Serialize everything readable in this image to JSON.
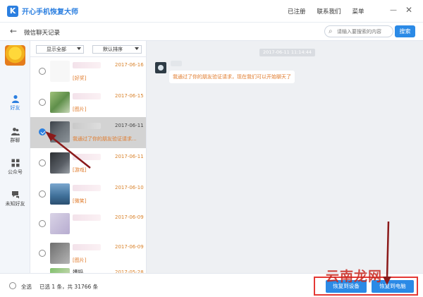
{
  "app": {
    "title": "开心手机恢复大师",
    "logo_letter": "K",
    "links": [
      "已注册",
      "联系我们",
      "菜单"
    ],
    "window_controls": [
      "minimize-icon",
      "maximize-icon",
      "close-icon"
    ]
  },
  "header": {
    "page_title": "微信聊天记录",
    "search_placeholder": "请输入要搜索的内容",
    "search_button": "搜索"
  },
  "nav": {
    "items": [
      {
        "label": "好友",
        "icon": "person-icon",
        "active": true
      },
      {
        "label": "群聊",
        "icon": "group-icon",
        "active": false
      },
      {
        "label": "公众号",
        "icon": "grid-icon",
        "active": false
      },
      {
        "label": "未知好友",
        "icon": "chat-icon",
        "active": false
      }
    ]
  },
  "list": {
    "filter_show": "显示全部",
    "filter_sort": "默认排序",
    "rows": [
      {
        "date": "2017-06-16",
        "message": "[好奖]",
        "selected": false,
        "name": ""
      },
      {
        "date": "2017-06-15",
        "message": "[图片]",
        "selected": false,
        "name": ""
      },
      {
        "date": "2017-06-11",
        "message": "我通过了你的朋友验证请求...",
        "selected": true,
        "name": ""
      },
      {
        "date": "2017-06-11",
        "message": "[游戏]",
        "selected": false,
        "name": ""
      },
      {
        "date": "2017-06-10",
        "message": "[微笑]",
        "selected": false,
        "name": ""
      },
      {
        "date": "2017-06-09",
        "message": "",
        "selected": false,
        "name": ""
      },
      {
        "date": "2017-06-09",
        "message": "[图片]",
        "selected": false,
        "name": ""
      },
      {
        "date": "2017-05-28",
        "message": "",
        "selected": false,
        "name": "姨妈"
      }
    ]
  },
  "chat": {
    "timestamp": "2017-06-11 11:14:44",
    "message": "我通过了你的朋友验证请求，现在我们可以开始聊天了"
  },
  "footer": {
    "select_all": "全选",
    "selection": "已选 1 条，共 31766 条",
    "recover_phone_button": "恢复到设备",
    "recover_pc_button": "恢复到电脑"
  },
  "watermark": "云南龙网",
  "colors": {
    "accent": "#2b7fe0",
    "highlight": "#e07a2a",
    "annotation": "#8b1a1a",
    "outline": "#e53935"
  }
}
